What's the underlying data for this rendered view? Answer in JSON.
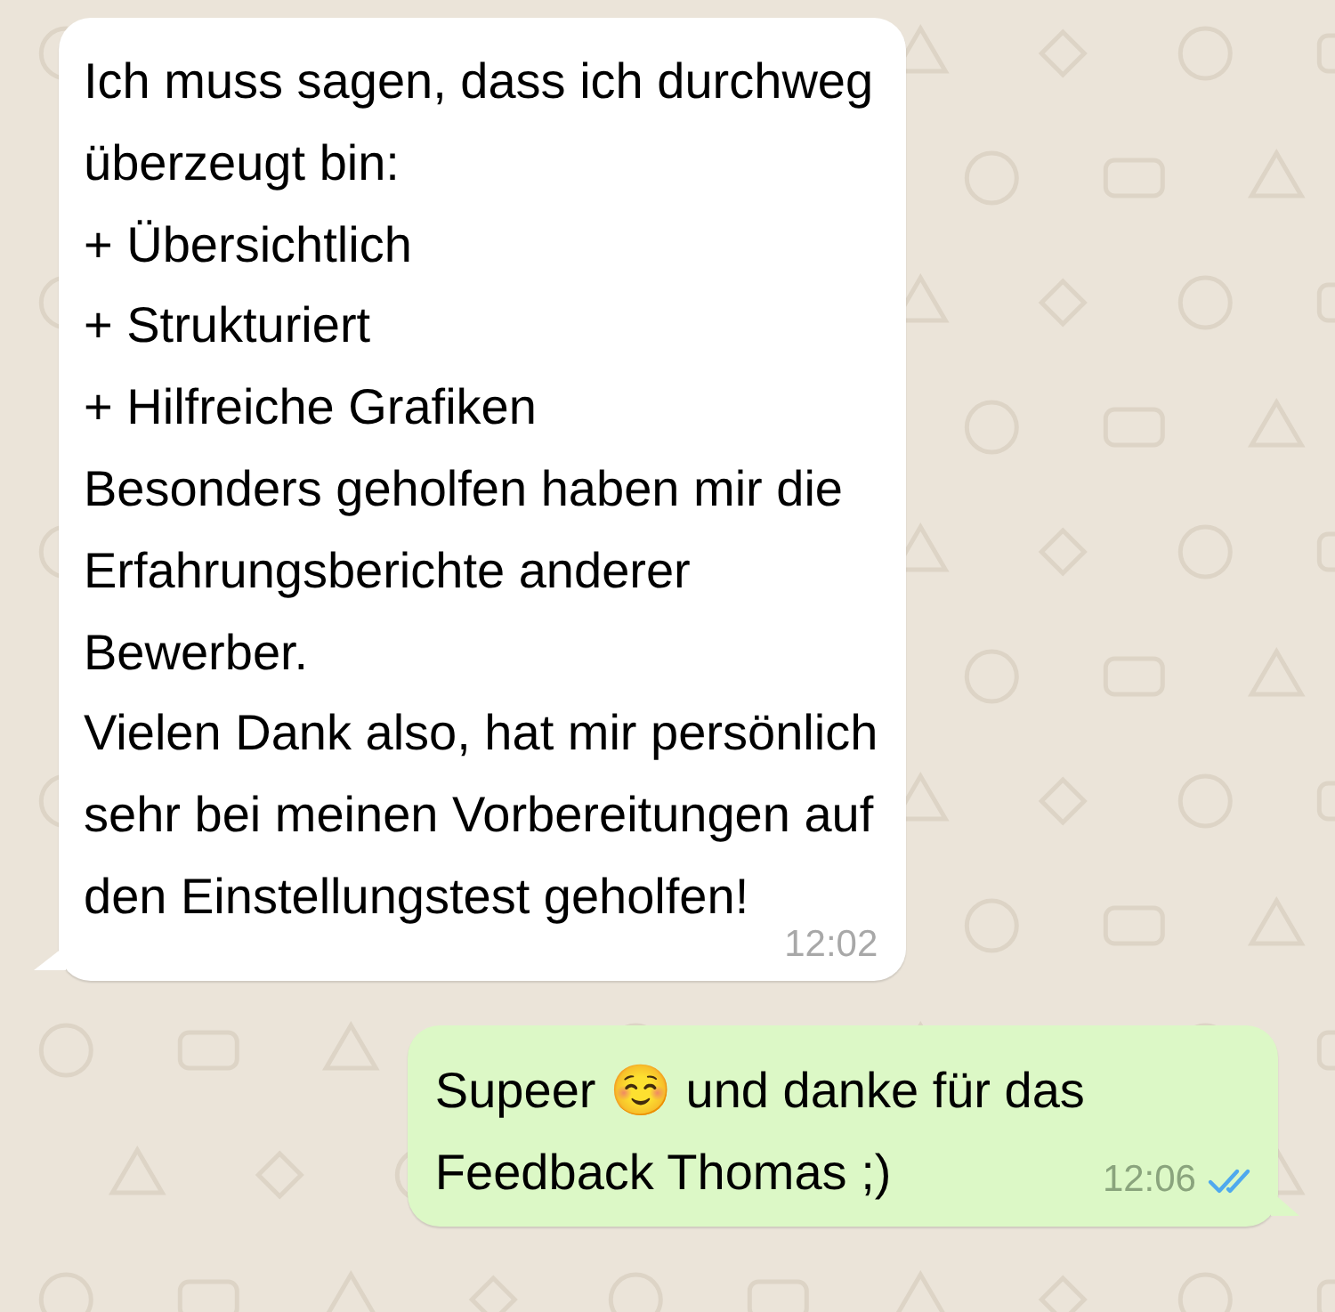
{
  "messages": [
    {
      "kind": "incoming",
      "text": "Ich muss sagen, dass ich durchweg\nüberzeugt bin:\n+ Übersichtlich\n+ Strukturiert\n+ Hilfreiche Grafiken\nBesonders geholfen haben mir die\nErfahrungsberichte anderer\nBewerber.\nVielen Dank also, hat mir persönlich\nsehr bei meinen Vorbereitungen auf\nden Einstellungstest geholfen!",
      "time": "12:02"
    },
    {
      "kind": "outgoing",
      "text": "Supeer ☺️ und danke für das\nFeedback Thomas ;)",
      "time": "12:06",
      "read": true
    }
  ]
}
